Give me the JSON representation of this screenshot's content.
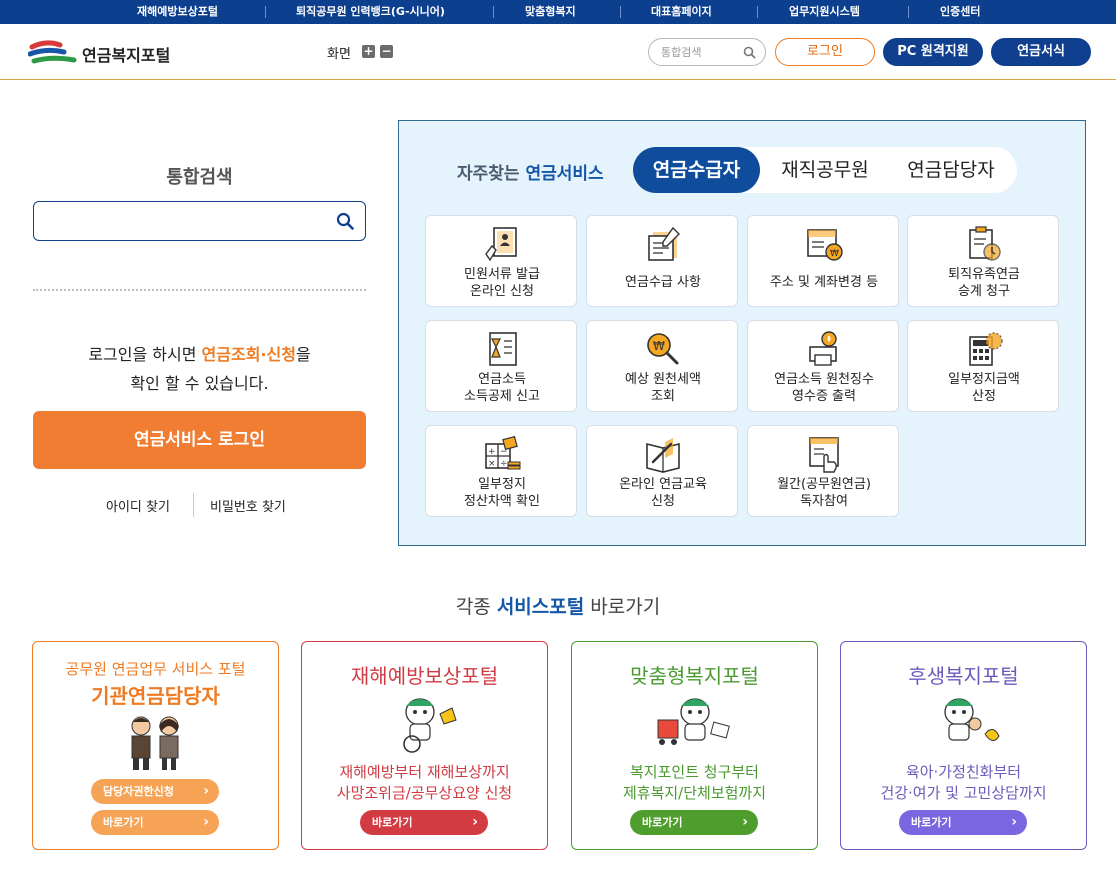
{
  "topbar": {
    "links": [
      "재해예방보상포털",
      "퇴직공무원 인력뱅크(G-시니어)",
      "맞춤형복지",
      "대표홈페이지",
      "업무지원시스템",
      "인증센터"
    ]
  },
  "header": {
    "logo_text": "연금복지포털",
    "zoom_label": "화면",
    "zoom_in": "+",
    "zoom_out": "−",
    "search_placeholder": "통합검색",
    "login": "로그인",
    "pc_support": "PC 원격지원",
    "forms": "연금서식"
  },
  "left": {
    "search_title": "통합검색",
    "msg_line1_pre": "로그인을 하시면 ",
    "msg_line1_hl": "연금조회·신청",
    "msg_line1_post": "을",
    "msg_line2": "확인 할 수 있습니다.",
    "login_button": "연금서비스 로그인",
    "find_id": "아이디 찾기",
    "find_pw": "비밀번호 찾기"
  },
  "services": {
    "title_pre": "자주찾는 ",
    "title_hl": "연금서비스",
    "tabs": [
      "연금수급자",
      "재직공무원",
      "연금담당자"
    ],
    "active_tab": 0,
    "cards": [
      {
        "line1": "민원서류 발급",
        "line2": "온라인 신청",
        "icon": "document-person-icon"
      },
      {
        "line1": "연금수급 사항",
        "line2": "",
        "icon": "pen-document-icon"
      },
      {
        "line1": "주소 및 계좌변경 등",
        "line2": "",
        "icon": "bankbook-coin-icon"
      },
      {
        "line1": "퇴직유족연금",
        "line2": "승계 청구",
        "icon": "clipboard-clock-icon"
      },
      {
        "line1": "연금소득",
        "line2": "소득공제 신고",
        "icon": "hourglass-checklist-icon"
      },
      {
        "line1": "예상 원천세액",
        "line2": "조회",
        "icon": "coin-magnifier-icon"
      },
      {
        "line1": "연금소득 원천징수",
        "line2": "영수증 출력",
        "icon": "printer-icon"
      },
      {
        "line1": "일부정지금액",
        "line2": "산정",
        "icon": "calculator-icon"
      },
      {
        "line1": "일부정지",
        "line2": "정산차액 확인",
        "icon": "math-coins-icon"
      },
      {
        "line1": "온라인 연금교육",
        "line2": "신청",
        "icon": "book-pen-icon"
      },
      {
        "line1": "월간(공무원연금)",
        "line2": "독자참여",
        "icon": "magazine-hand-icon"
      }
    ]
  },
  "portals": {
    "title_pre": "각종 ",
    "title_hl": "서비스포털",
    "title_post": " 바로가기",
    "cards": [
      {
        "sub": "공무원 연금업무 서비스 포털",
        "name": "기관연금담당자",
        "desc1": "",
        "desc2": "",
        "btn1": "담당자권한신청",
        "btn2": "바로가기",
        "color": "#ee7a22",
        "pill": "#f7a355"
      },
      {
        "sub": "",
        "name": "재해예방보상포털",
        "desc1": "재해예방부터 재해보상까지",
        "desc2": "사망조위금/공무상요양 신청",
        "btn1": "",
        "btn2": "바로가기",
        "color": "#d13c44",
        "pill": "#d33b43"
      },
      {
        "sub": "",
        "name": "맞춤형복지포털",
        "desc1": "복지포인트 청구부터",
        "desc2": "제휴복지/단체보험까지",
        "btn1": "",
        "btn2": "바로가기",
        "color": "#4a9b2f",
        "pill": "#4f9d2c"
      },
      {
        "sub": "",
        "name": "후생복지포털",
        "desc1": "육아·가정친화부터",
        "desc2": "건강·여가 및 고민상담까지",
        "btn1": "",
        "btn2": "바로가기",
        "color": "#6b5bbd",
        "pill": "#7a66e0"
      }
    ]
  }
}
